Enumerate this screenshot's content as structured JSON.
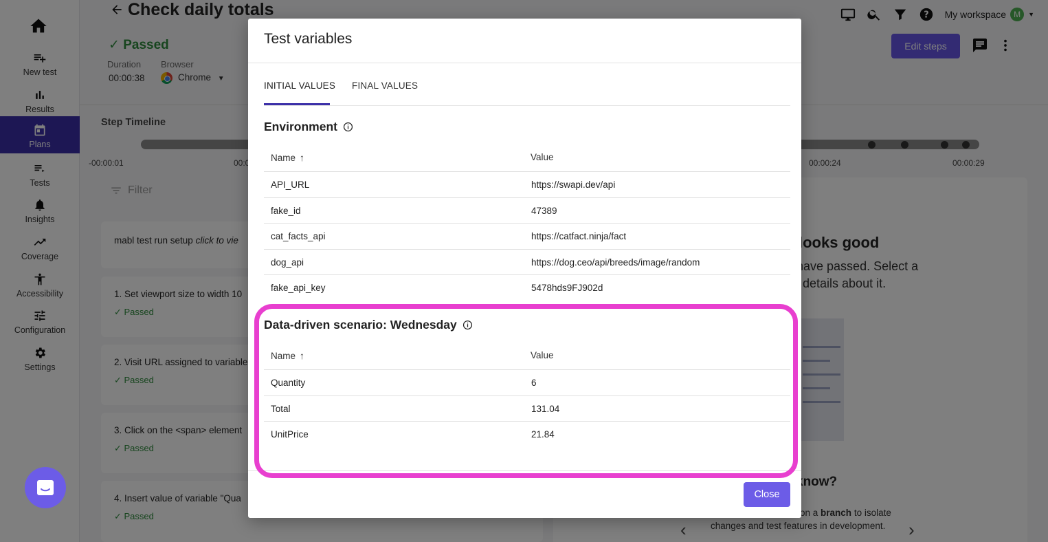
{
  "sidebar": {
    "items": [
      {
        "label": "New test",
        "icon": "playlist-add-icon"
      },
      {
        "label": "Results",
        "icon": "bar-chart-icon"
      },
      {
        "label": "Plans",
        "icon": "calendar-icon"
      },
      {
        "label": "Tests",
        "icon": "list-icon"
      },
      {
        "label": "Insights",
        "icon": "bell-icon"
      },
      {
        "label": "Coverage",
        "icon": "trending-up-icon"
      },
      {
        "label": "Accessibility",
        "icon": "accessibility-icon"
      },
      {
        "label": "Configuration",
        "icon": "tune-icon"
      },
      {
        "label": "Settings",
        "icon": "gear-icon"
      }
    ],
    "active_index": 2
  },
  "page": {
    "title": "Check daily totals",
    "status": "Passed",
    "duration_label": "Duration",
    "duration_value": "00:00:38",
    "browser_label": "Browser",
    "browser_value": "Chrome",
    "workspace": "My workspace",
    "workspace_avatar": "M",
    "edit_steps": "Edit steps",
    "step_timeline": "Step Timeline",
    "timeline_labels": [
      "-00:00:01",
      "00:0",
      "00:00:24",
      "00:00:29"
    ],
    "filter_placeholder": "Filter",
    "steps": [
      {
        "title_prefix": "mabl test run setup",
        "title_italic": "click to vie",
        "status": ""
      },
      {
        "title": "1. Set viewport size to width 10",
        "status": "Passed"
      },
      {
        "title": "2. Visit URL assigned to variable",
        "status": "Passed"
      },
      {
        "title": "3. Click on the <span> element",
        "status": "Passed"
      },
      {
        "title": "4. Insert value of variable \"Qua",
        "status": "Passed"
      }
    ],
    "right_title": "looks good",
    "right_text_1": "st have passed. Select a",
    "right_text_2": "details about it.",
    "right_know": "know?",
    "right_hint_1_prefix": "on a",
    "right_hint_1_bold": "branch",
    "right_hint_1_suffix": "to isolate",
    "right_hint_2": "changes and test features in development."
  },
  "modal": {
    "title": "Test variables",
    "tabs": [
      {
        "label": "INITIAL VALUES",
        "active": true
      },
      {
        "label": "FINAL VALUES",
        "active": false
      }
    ],
    "environment": {
      "title": "Environment",
      "col_name": "Name",
      "col_value": "Value",
      "rows": [
        {
          "name": "API_URL",
          "value": "https://swapi.dev/api"
        },
        {
          "name": "fake_id",
          "value": "47389"
        },
        {
          "name": "cat_facts_api",
          "value": "https://catfact.ninja/fact"
        },
        {
          "name": "dog_api",
          "value": "https://dog.ceo/api/breeds/image/random"
        },
        {
          "name": "fake_api_key",
          "value": "5478hds9FJ902d"
        }
      ]
    },
    "scenario": {
      "title": "Data-driven scenario: Wednesday",
      "col_name": "Name",
      "col_value": "Value",
      "rows": [
        {
          "name": "Quantity",
          "value": "6"
        },
        {
          "name": "Total",
          "value": "131.04"
        },
        {
          "name": "UnitPrice",
          "value": "21.84"
        }
      ]
    },
    "close": "Close"
  },
  "colors": {
    "accent": "#6c5ce7",
    "sidebar_active": "#3b2fa8",
    "passed": "#2e8b3d",
    "highlight": "#e83fcf"
  }
}
